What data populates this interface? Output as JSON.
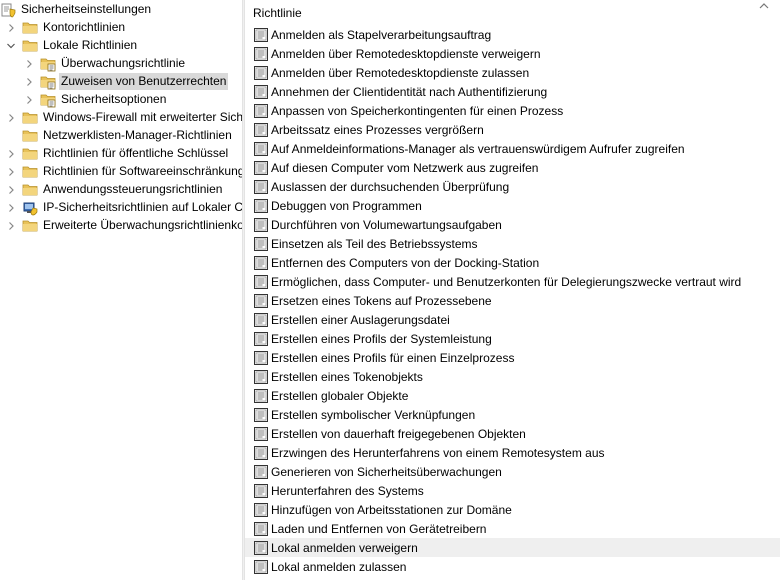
{
  "tree": {
    "root": "Sicherheitseinstellungen",
    "items": [
      {
        "label": "Kontorichtlinien",
        "level": 1,
        "expanded": false,
        "icon": "folder-icon"
      },
      {
        "label": "Lokale Richtlinien",
        "level": 1,
        "expanded": true,
        "icon": "folder-icon"
      },
      {
        "label": "Überwachungsrichtlinie",
        "level": 2,
        "expanded": false,
        "icon": "policy-folder-icon"
      },
      {
        "label": "Zuweisen von Benutzerrechten",
        "level": 2,
        "expanded": false,
        "icon": "policy-folder-icon",
        "selected": true
      },
      {
        "label": "Sicherheitsoptionen",
        "level": 2,
        "expanded": false,
        "icon": "policy-folder-icon"
      },
      {
        "label": "Windows-Firewall mit erweiterter Sich",
        "level": 1,
        "expanded": false,
        "icon": "folder-icon"
      },
      {
        "label": "Netzwerklisten-Manager-Richtlinien",
        "level": 1,
        "expanded": null,
        "icon": "folder-icon"
      },
      {
        "label": "Richtlinien für öffentliche Schlüssel",
        "level": 1,
        "expanded": false,
        "icon": "folder-icon"
      },
      {
        "label": "Richtlinien für Softwareeinschränkung",
        "level": 1,
        "expanded": false,
        "icon": "folder-icon"
      },
      {
        "label": "Anwendungssteuerungsrichtlinien",
        "level": 1,
        "expanded": false,
        "icon": "folder-icon"
      },
      {
        "label": "IP-Sicherheitsrichtlinien auf Lokaler C",
        "level": 1,
        "expanded": false,
        "icon": "ip-security-icon"
      },
      {
        "label": "Erweiterte Überwachungsrichtlinienko",
        "level": 1,
        "expanded": false,
        "icon": "folder-icon"
      }
    ]
  },
  "list": {
    "header": "Richtlinie",
    "items": [
      "Anmelden als Stapelverarbeitungsauftrag",
      "Anmelden über Remotedesktopdienste verweigern",
      "Anmelden über Remotedesktopdienste zulassen",
      "Annehmen der Clientidentität nach Authentifizierung",
      "Anpassen von Speicherkontingenten für einen Prozess",
      "Arbeitssatz eines Prozesses vergrößern",
      "Auf Anmeldeinformations-Manager als vertrauenswürdigem Aufrufer zugreifen",
      "Auf diesen Computer vom Netzwerk aus zugreifen",
      "Auslassen der durchsuchenden Überprüfung",
      "Debuggen von Programmen",
      "Durchführen von Volumewartungsaufgaben",
      "Einsetzen als Teil des Betriebssystems",
      "Entfernen des Computers von der Docking-Station",
      "Ermöglichen, dass Computer- und Benutzerkonten für Delegierungszwecke vertraut wird",
      "Ersetzen eines Tokens auf Prozessebene",
      "Erstellen einer Auslagerungsdatei",
      "Erstellen eines Profils der Systemleistung",
      "Erstellen eines Profils für einen Einzelprozess",
      "Erstellen eines Tokenobjekts",
      "Erstellen globaler Objekte",
      "Erstellen symbolischer Verknüpfungen",
      "Erstellen von dauerhaft freigegebenen Objekten",
      "Erzwingen des Herunterfahrens von einem Remotesystem aus",
      "Generieren von Sicherheitsüberwachungen",
      "Herunterfahren des Systems",
      "Hinzufügen von Arbeitsstationen zur Domäne",
      "Laden und Entfernen von Gerätetreibern",
      "Lokal anmelden verweigern",
      "Lokal anmelden zulassen"
    ],
    "hover_index": 27
  },
  "colors": {
    "selected_bg": "#d9d9d9",
    "hover_bg": "#efefef",
    "folder": "#e8c25a"
  }
}
